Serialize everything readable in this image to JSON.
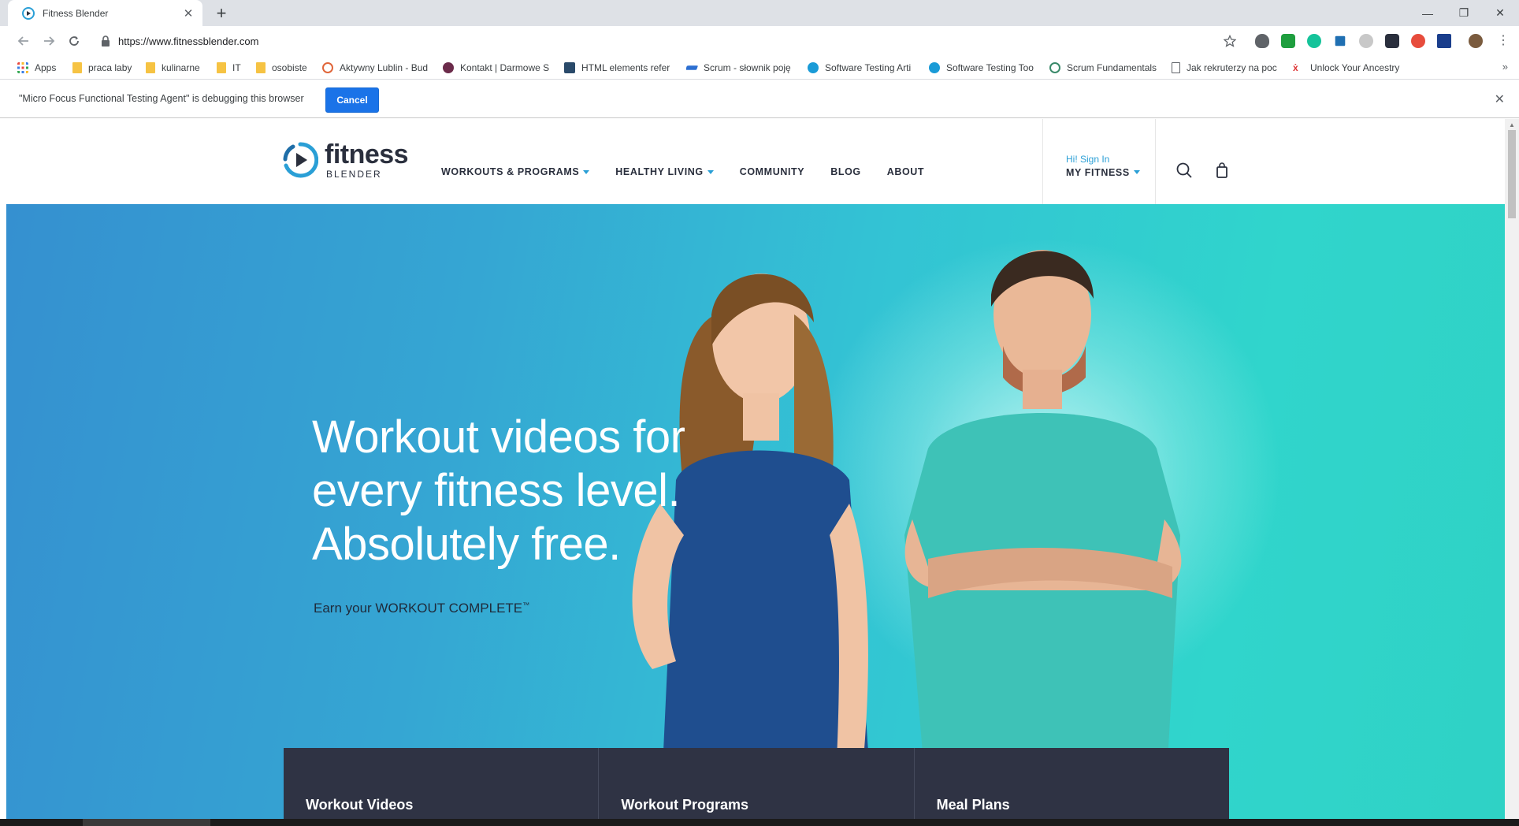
{
  "browser": {
    "tab_title": "Fitness Blender",
    "tab_close": "✕",
    "new_tab": "+",
    "window_controls": {
      "minimize": "—",
      "restore": "❐",
      "close": "✕"
    },
    "url": "https://www.fitnessblender.com",
    "bookmarks": [
      {
        "label": "Apps",
        "icon": "apps-grid-icon"
      },
      {
        "label": "praca laby",
        "icon": "folder-icon"
      },
      {
        "label": "kulinarne",
        "icon": "folder-icon"
      },
      {
        "label": "IT",
        "icon": "folder-icon"
      },
      {
        "label": "osobiste",
        "icon": "folder-icon"
      },
      {
        "label": "Aktywny Lublin - Bud",
        "icon": "site-icon"
      },
      {
        "label": "Kontakt | Darmowe S",
        "icon": "site-icon"
      },
      {
        "label": "HTML elements refer",
        "icon": "site-icon"
      },
      {
        "label": "Scrum - słownik poję",
        "icon": "site-icon"
      },
      {
        "label": "Software Testing Arti",
        "icon": "site-icon"
      },
      {
        "label": "Software Testing Too",
        "icon": "site-icon"
      },
      {
        "label": "Scrum Fundamentals",
        "icon": "site-icon"
      },
      {
        "label": "Jak rekruterzy na poc",
        "icon": "page-icon"
      },
      {
        "label": "Unlock Your Ancestry",
        "icon": "site-icon"
      }
    ],
    "bookmarks_more": "»",
    "infobar": {
      "message": "\"Micro Focus Functional Testing Agent\" is debugging this browser",
      "cancel_label": "Cancel",
      "close": "✕"
    }
  },
  "site": {
    "logo_word": "fitness",
    "logo_sub": "BLENDER",
    "nav": [
      {
        "label": "WORKOUTS & PROGRAMS",
        "dropdown": true
      },
      {
        "label": "HEALTHY LIVING",
        "dropdown": true
      },
      {
        "label": "COMMUNITY",
        "dropdown": false
      },
      {
        "label": "BLOG",
        "dropdown": false
      },
      {
        "label": "ABOUT",
        "dropdown": false
      }
    ],
    "signin_greeting": "Hi! Sign In",
    "my_fitness": "MY FITNESS",
    "hero": {
      "title_line1": "Workout videos for",
      "title_line2": "every fitness level.",
      "title_line3": "Absolutely free.",
      "subtitle": "Earn your WORKOUT COMPLETE",
      "trademark": "™"
    },
    "cards": [
      {
        "title": "Workout Videos"
      },
      {
        "title": "Workout Programs"
      },
      {
        "title": "Meal Plans"
      }
    ]
  },
  "colors": {
    "accent_blue": "#2a9fd6",
    "dark_navy": "#2a2f3d",
    "card_bg": "#2f3344",
    "chrome_button_blue": "#1a73e8"
  }
}
